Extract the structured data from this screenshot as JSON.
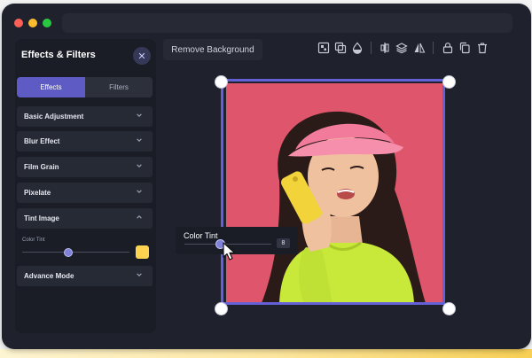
{
  "panel": {
    "title": "Effects & Filters",
    "close_icon": "close-icon",
    "tabs": [
      {
        "label": "Effects",
        "active": true
      },
      {
        "label": "Filters",
        "active": false
      }
    ],
    "items": [
      {
        "label": "Basic Adjustment",
        "expanded": false
      },
      {
        "label": "Blur Effect",
        "expanded": false
      },
      {
        "label": "Film Grain",
        "expanded": false
      },
      {
        "label": "Pixelate",
        "expanded": false
      },
      {
        "label": "Tint Image",
        "expanded": true
      },
      {
        "label": "Advance Mode",
        "expanded": false
      }
    ],
    "tint": {
      "label": "Color Tint",
      "slider_fraction": 0.42,
      "swatch_color": "#ffd24f"
    }
  },
  "toolbar": {
    "remove_background": "Remove Background",
    "icons": [
      "align-icon",
      "duplicate-layer-icon",
      "opacity-icon",
      "distribute-icon",
      "layers-icon",
      "flip-icon",
      "lock-icon",
      "copy-icon",
      "trash-icon"
    ]
  },
  "popup": {
    "label": "Color Tint",
    "value": "8"
  },
  "colors": {
    "accent": "#5e5cc4",
    "selection": "#6461d6",
    "photo_background": "#e0586e"
  }
}
